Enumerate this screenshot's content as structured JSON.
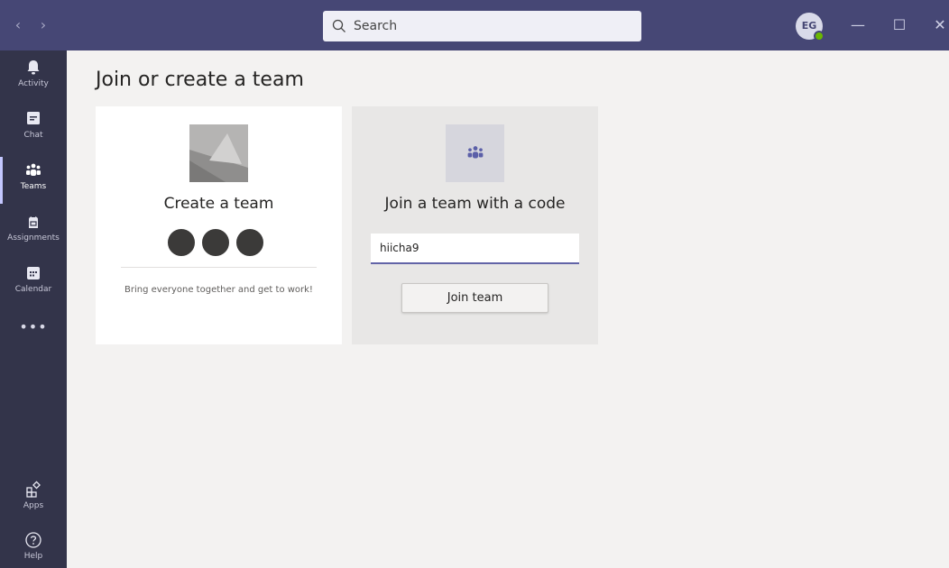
{
  "titlebar": {
    "back_label": "‹",
    "forward_label": "›",
    "search_placeholder": "Search",
    "avatar_initials": "EG",
    "minimize_label": "—",
    "maximize_label": "☐",
    "close_label": "✕"
  },
  "rail": {
    "items": [
      {
        "label": "Activity",
        "icon": "bell-icon"
      },
      {
        "label": "Chat",
        "icon": "chat-icon"
      },
      {
        "label": "Teams",
        "icon": "teams-icon",
        "active": true
      },
      {
        "label": "Assignments",
        "icon": "assignments-icon"
      },
      {
        "label": "Calendar",
        "icon": "calendar-icon"
      }
    ],
    "more_label": "•••",
    "bottom_items": [
      {
        "label": "Apps",
        "icon": "apps-icon"
      },
      {
        "label": "Help",
        "icon": "help-icon"
      }
    ]
  },
  "main": {
    "page_title": "Join or create a team",
    "create_card": {
      "title": "Create a team",
      "description": "Bring everyone together and get to work!"
    },
    "join_card": {
      "title": "Join a team with a code",
      "code_value": "hiicha9",
      "button_label": "Join team"
    }
  },
  "colors": {
    "titlebar": "#464775",
    "rail": "#33344a",
    "accent": "#6264a7",
    "background": "#f3f2f1"
  }
}
